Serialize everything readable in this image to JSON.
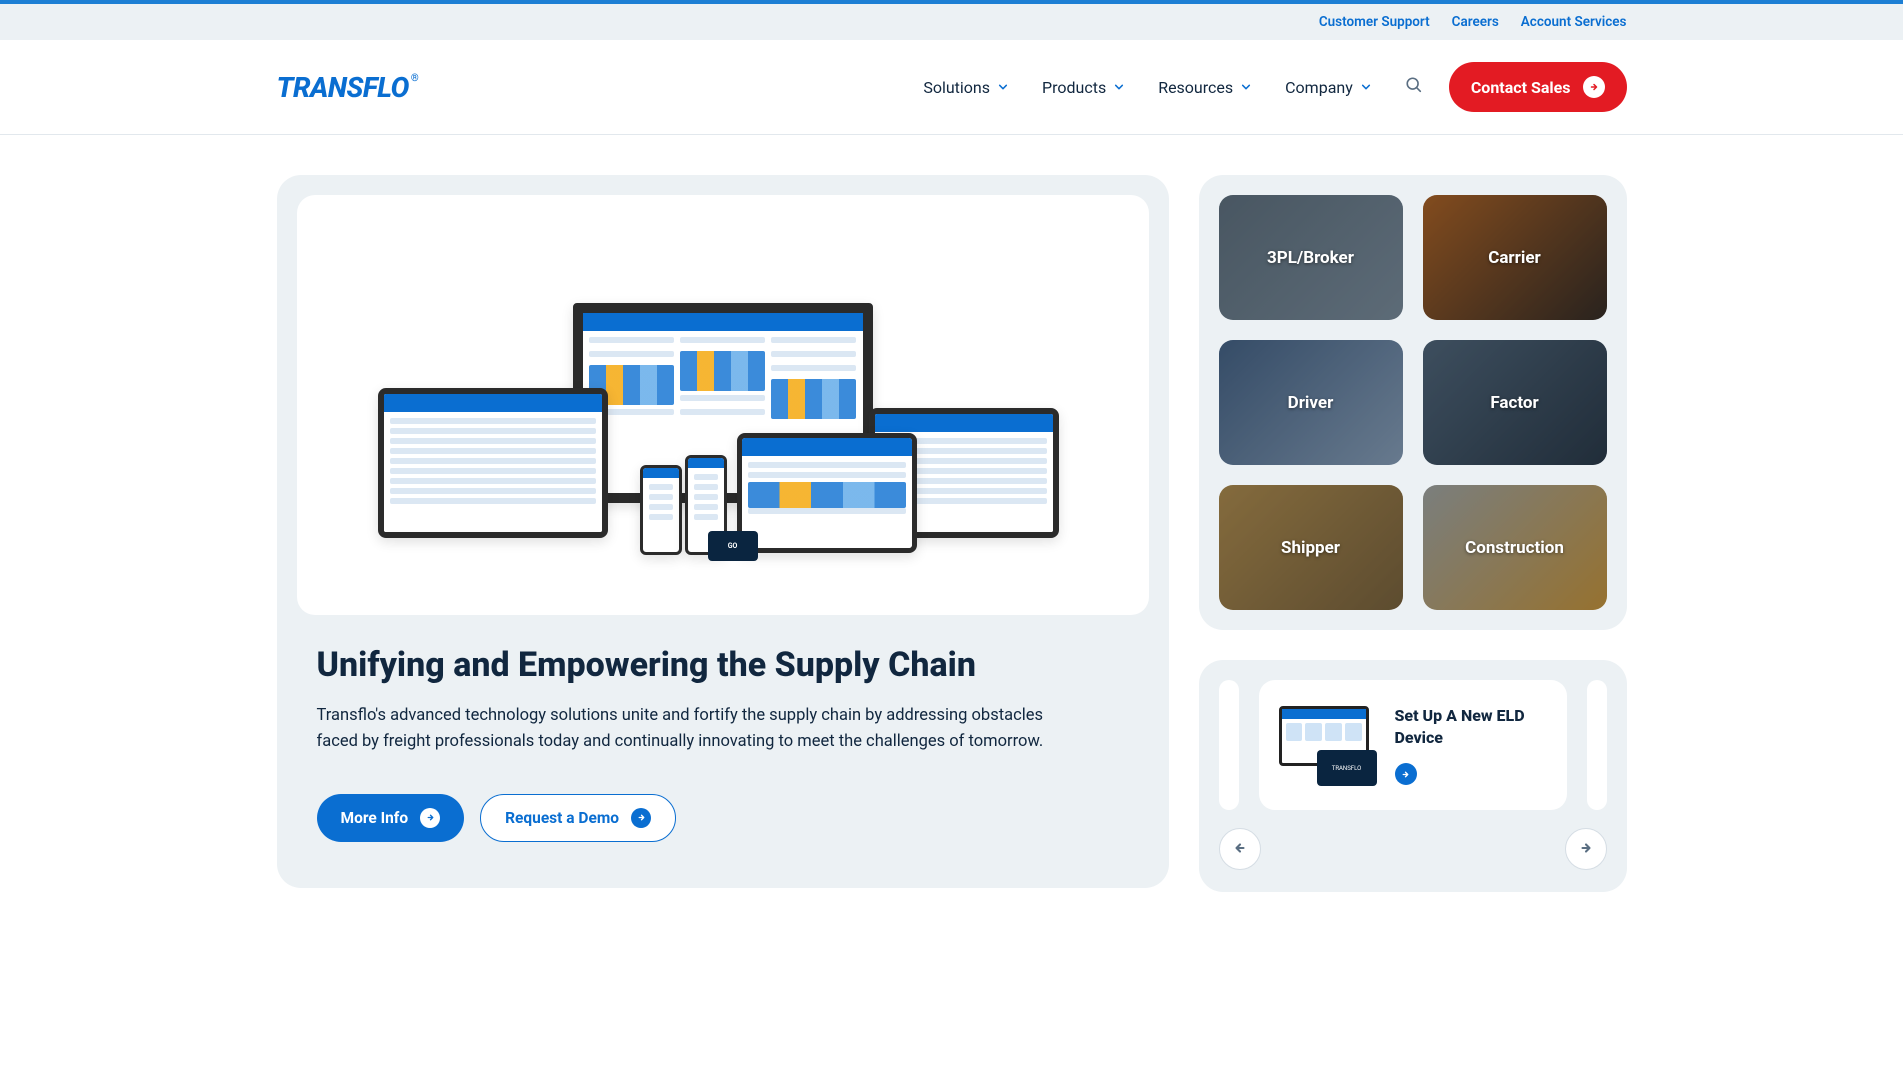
{
  "topNav": {
    "links": [
      "Customer Support",
      "Careers",
      "Account Services"
    ]
  },
  "mainNav": {
    "logo": "TRANSFLO",
    "logoSup": "®",
    "items": [
      "Solutions",
      "Products",
      "Resources",
      "Company"
    ],
    "cta": "Contact Sales"
  },
  "hero": {
    "title": "Unifying and Empowering the Supply Chain",
    "desc": "Transflo's advanced technology solutions unite and fortify the supply chain by addressing obstacles faced by freight professionals today and continually innovating to meet the challenges of tomorrow.",
    "btnPrimary": "More Info",
    "btnSecondary": "Request a Demo"
  },
  "categories": [
    "3PL/Broker",
    "Carrier",
    "Driver",
    "Factor",
    "Shipper",
    "Construction"
  ],
  "carousel": {
    "itemTitle": "Set Up A New ELD Device"
  }
}
